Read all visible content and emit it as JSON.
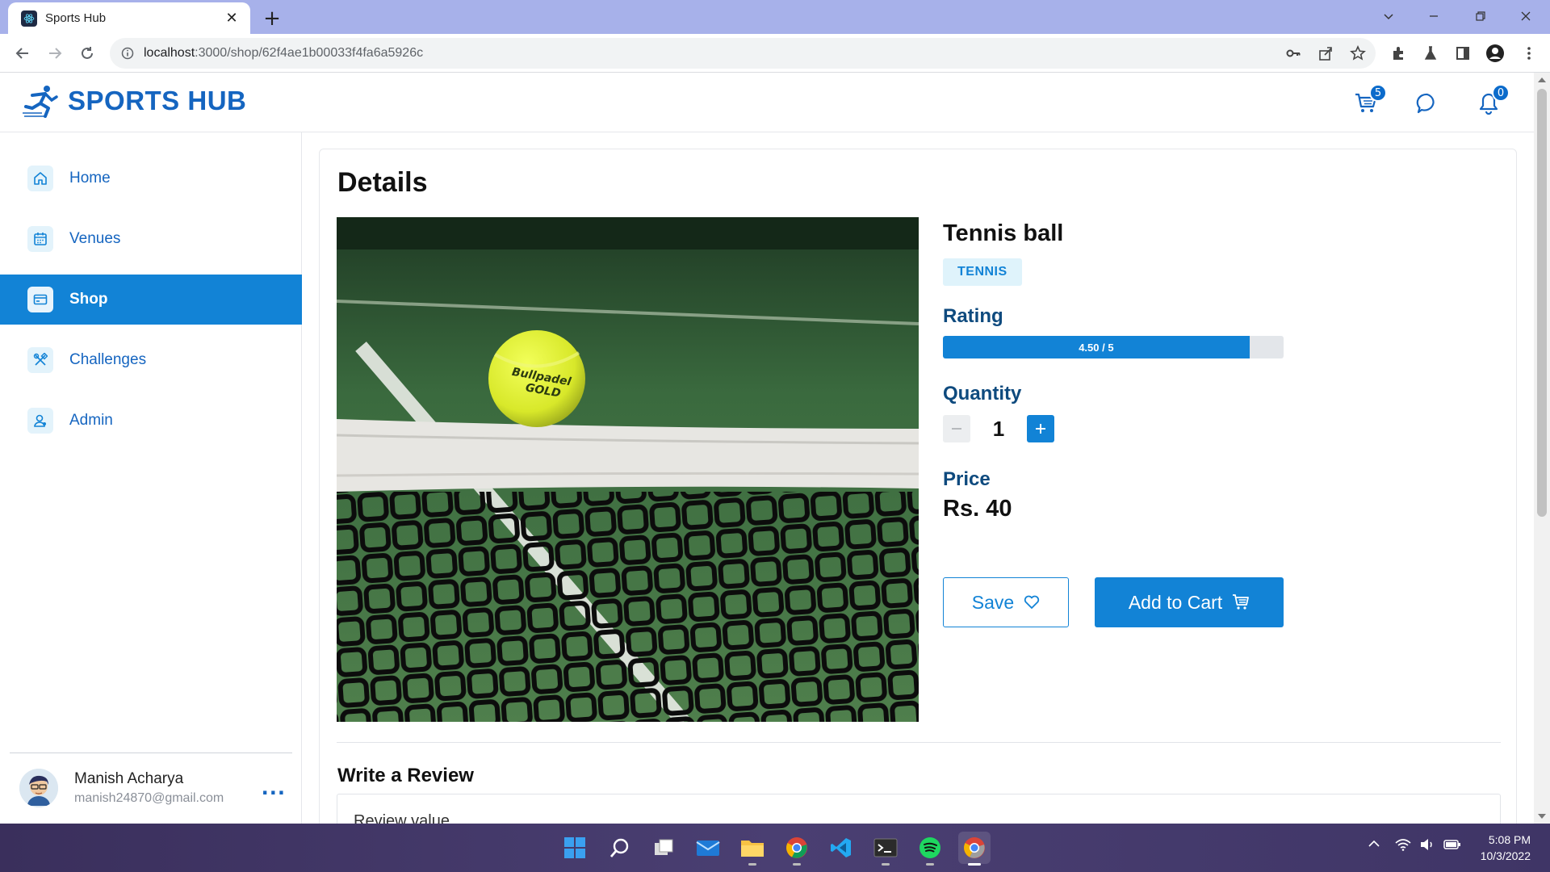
{
  "browser": {
    "tab_title": "Sports Hub",
    "url_host": "localhost",
    "url_path": ":3000/shop/62f4ae1b00033f4fa6a5926c"
  },
  "header": {
    "brand": "SPORTS HUB",
    "cart_count": "5",
    "notification_count": "0"
  },
  "sidebar": {
    "items": [
      {
        "label": "Home",
        "icon": "home-icon"
      },
      {
        "label": "Venues",
        "icon": "calendar-icon"
      },
      {
        "label": "Shop",
        "icon": "credit-card-icon",
        "active": true
      },
      {
        "label": "Challenges",
        "icon": "tools-icon"
      },
      {
        "label": "Admin",
        "icon": "user-icon"
      }
    ],
    "user": {
      "name": "Manish Acharya",
      "email": "manish24870@gmail.com",
      "more": "..."
    }
  },
  "main": {
    "title": "Details",
    "product": {
      "name": "Tennis ball",
      "tag": "TENNIS",
      "rating_label": "Rating",
      "rating_text": "4.50 / 5",
      "rating_value": 4.5,
      "rating_max": 5,
      "quantity_label": "Quantity",
      "quantity": "1",
      "price_label": "Price",
      "price": "Rs. 40",
      "image_text_line1": "Bullpadel",
      "image_text_line2": "GOLD"
    },
    "actions": {
      "save_label": "Save",
      "add_to_cart_label": "Add to Cart"
    },
    "review": {
      "title": "Write a Review",
      "field_label": "Review value"
    }
  },
  "taskbar": {
    "time": "5:08 PM",
    "date": "10/3/2022"
  },
  "colors": {
    "accent": "#1283d6",
    "brand": "#1565c0"
  }
}
